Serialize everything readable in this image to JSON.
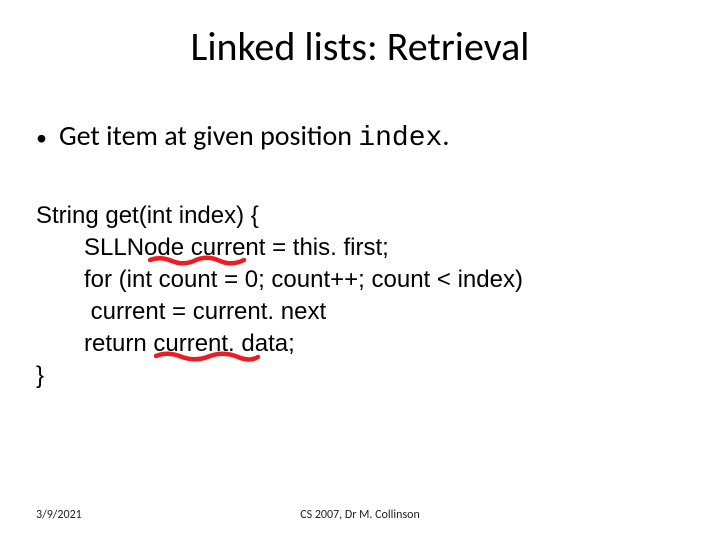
{
  "title": "Linked lists: Retrieval",
  "bullet": {
    "prefix": "Get item at given position ",
    "code": "index",
    "suffix": "."
  },
  "code": {
    "l1": "String get(int index) {",
    "l2": "SLLNode current = this. first;",
    "l3": "for (int count = 0; count++; count < index)",
    "l4": " current = current. next",
    "l5": "return current. data;",
    "l6": "}"
  },
  "footer": {
    "date": "3/9/2021",
    "course": "CS 2007,  Dr M. Collinson"
  },
  "annotation_color": "#ed1c24"
}
